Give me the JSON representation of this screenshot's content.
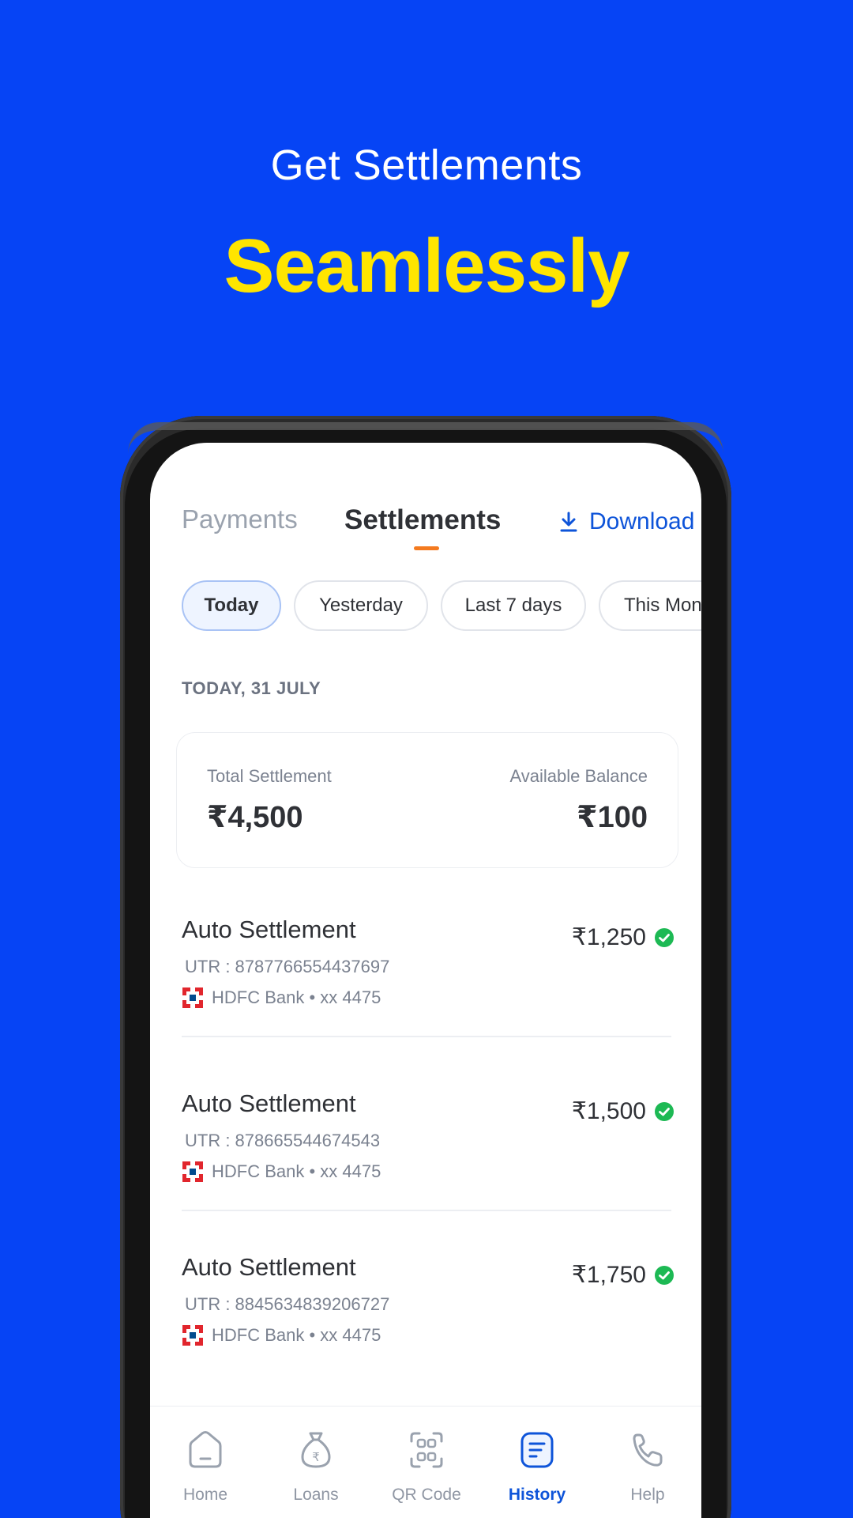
{
  "hero": {
    "subtitle": "Get Settlements",
    "headline": "Seamlessly"
  },
  "tabs": {
    "payments": "Payments",
    "settlements": "Settlements",
    "download": "Download"
  },
  "filters": [
    "Today",
    "Yesterday",
    "Last 7 days",
    "This Month"
  ],
  "filter_active": "Today",
  "date_label": "TODAY, 31 JULY",
  "summary": {
    "total_label": "Total Settlement",
    "total_value": "₹4,500",
    "balance_label": "Available Balance",
    "balance_value": "₹100"
  },
  "settlements": [
    {
      "title": "Auto Settlement",
      "utr": "UTR : 8787766554437697",
      "bank": "HDFC Bank • xx 4475",
      "amount": "₹1,250",
      "status": "success"
    },
    {
      "title": "Auto Settlement",
      "utr": "UTR : 878665544674543",
      "bank": "HDFC Bank • xx 4475",
      "amount": "₹1,500",
      "status": "success"
    },
    {
      "title": "Auto Settlement",
      "utr": "UTR : 8845634839206727",
      "bank": "HDFC Bank • xx 4475",
      "amount": "₹1,750",
      "status": "success"
    }
  ],
  "nav": {
    "items": [
      {
        "label": "Home",
        "icon": "home-icon"
      },
      {
        "label": "Loans",
        "icon": "money-bag-icon"
      },
      {
        "label": "QR Code",
        "icon": "qr-code-icon"
      },
      {
        "label": "History",
        "icon": "history-icon"
      },
      {
        "label": "Help",
        "icon": "phone-icon"
      }
    ],
    "active": "History"
  },
  "colors": {
    "background": "#0644F5",
    "headline": "#FFE500",
    "accent": "#0E54D9",
    "tab_indicator": "#F47A1F",
    "success": "#1DB954"
  }
}
